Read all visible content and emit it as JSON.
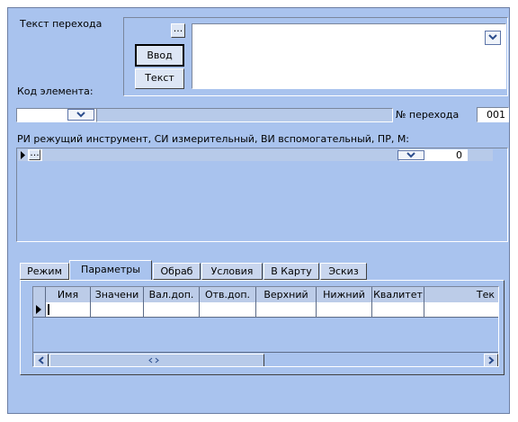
{
  "labels": {
    "transition_text": "Текст перехода",
    "element_code": "Код элемента:",
    "transition_number": "№ перехода",
    "tools": "РИ режущий инструмент, СИ измерительный, ВИ вспомогательный, ПР, М:"
  },
  "buttons": {
    "ellipsis": "...",
    "input": "Ввод",
    "text": "Текст"
  },
  "fields": {
    "transition_text_value": "",
    "element_code_value": "",
    "transition_number_value": "001",
    "tool_count": "0"
  },
  "tabs": [
    "Режим",
    "Параметры",
    "Обраб",
    "Условия",
    "В Карту",
    "Эскиз"
  ],
  "active_tab": "Параметры",
  "grid": {
    "columns": [
      "Имя",
      "Значени",
      "Вал.доп.",
      "Отв.доп.",
      "Верхний",
      "Нижний",
      "Квалитет",
      "Тек"
    ]
  },
  "colors": {
    "window": "#a9c3ee",
    "field": "#ffffff",
    "selection_row": "#a9c3ee"
  }
}
